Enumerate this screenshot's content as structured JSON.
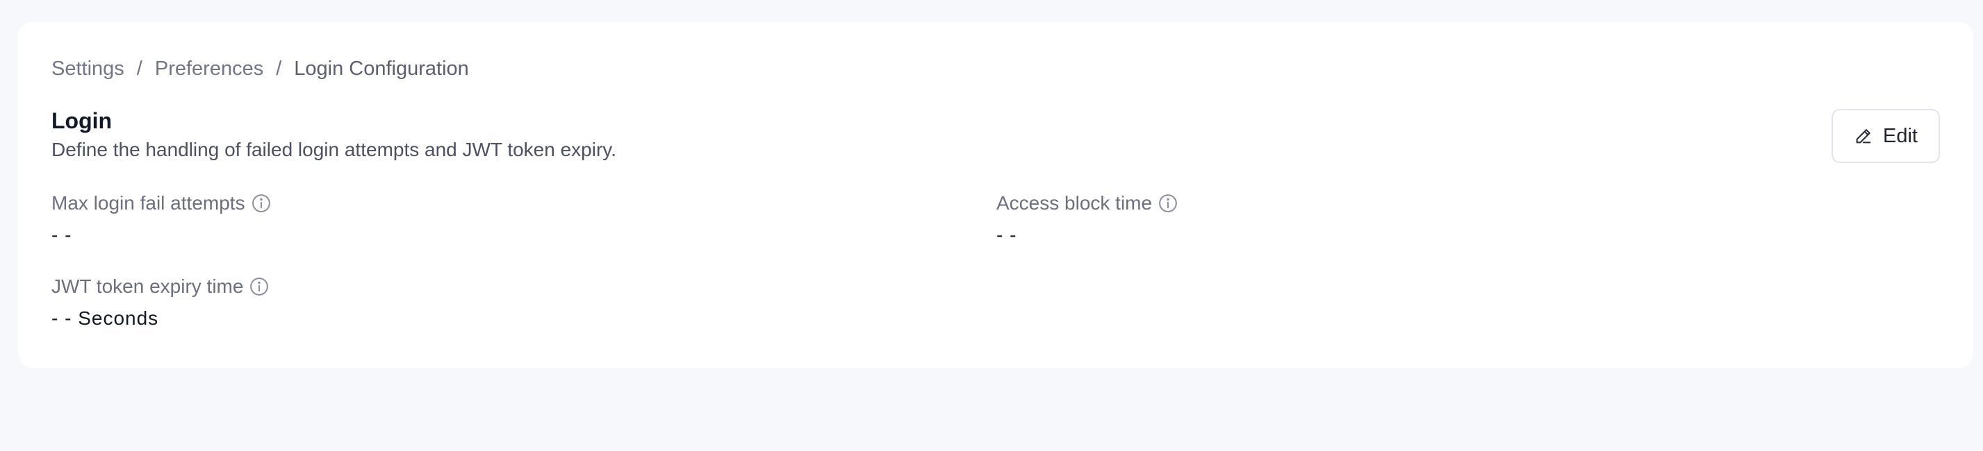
{
  "breadcrumb": {
    "items": [
      "Settings",
      "Preferences",
      "Login Configuration"
    ],
    "separator": "/"
  },
  "section": {
    "title": "Login",
    "description": "Define the handling of failed login attempts and JWT token expiry."
  },
  "actions": {
    "edit_label": "Edit"
  },
  "fields": {
    "max_login_fail_attempts": {
      "label": "Max login fail attempts",
      "value": "- -"
    },
    "access_block_time": {
      "label": "Access block time",
      "value": "- -"
    },
    "jwt_token_expiry_time": {
      "label": "JWT token expiry time",
      "value": "- - Seconds"
    }
  },
  "colors": {
    "page_bg": "#f7f8fc",
    "card_bg": "#ffffff",
    "text_primary": "#111827",
    "text_muted": "#6b6f7f"
  }
}
